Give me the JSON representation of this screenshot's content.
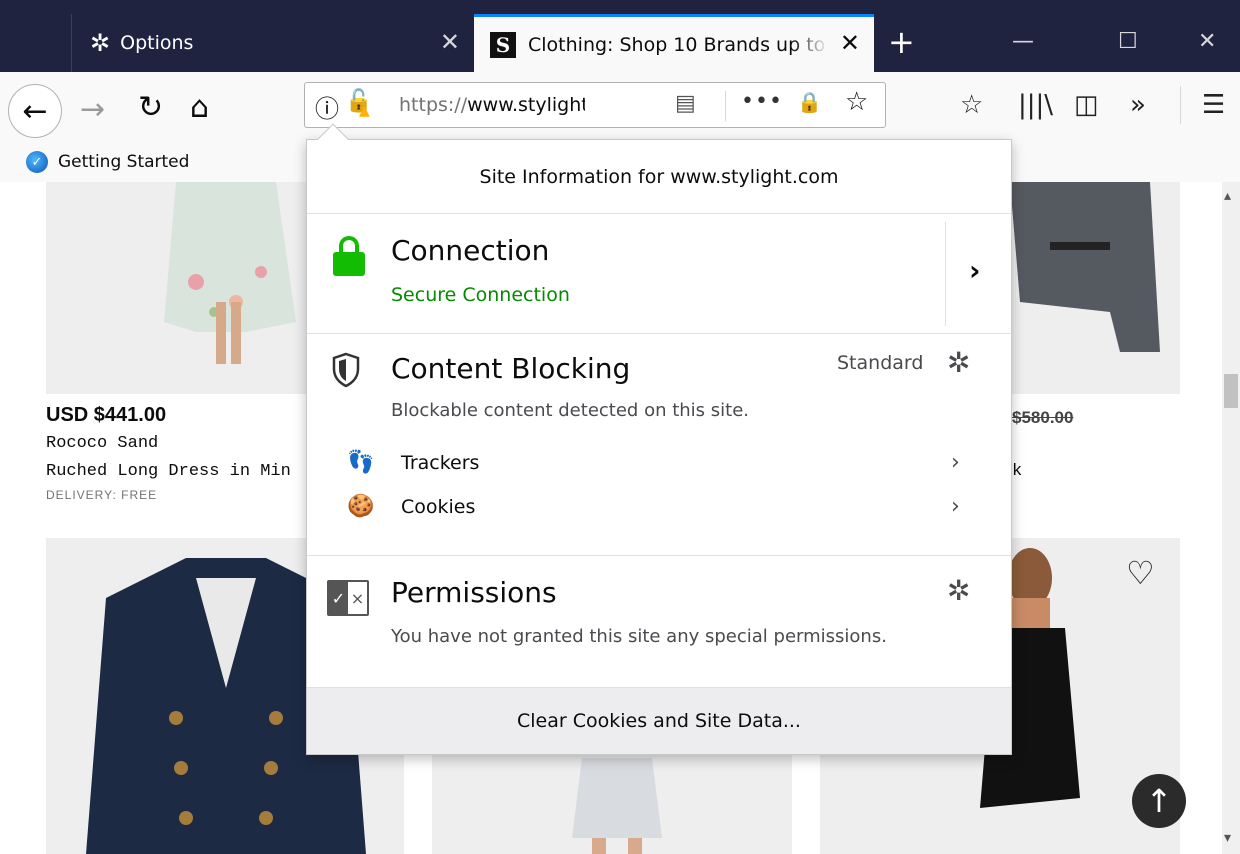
{
  "tabs": [
    {
      "title": "Options",
      "icon": "gear-icon",
      "active": false
    },
    {
      "title": "Clothing: Shop 10 Brands up to",
      "icon": "stylight-favicon",
      "favicon_letter": "S",
      "active": true
    }
  ],
  "window_controls": {
    "new_tab": "+",
    "minimize": "—",
    "maximize": "☐",
    "close": "✕"
  },
  "navbar": {
    "url_scheme": "https://",
    "url_host": "www.stylight",
    "icons": [
      "back-arrow-icon",
      "forward-arrow-icon",
      "reload-icon",
      "home-icon",
      "info-icon",
      "broken-lock-icon",
      "reader-view-icon",
      "page-actions-icon",
      "secure-lock-icon",
      "star-icon",
      "bookmarks-icon",
      "library-icon",
      "sidebar-icon",
      "overflow-icon",
      "menu-icon"
    ]
  },
  "bookmarks_toolbar": {
    "items": [
      {
        "label": "Getting Started"
      }
    ]
  },
  "products": [
    {
      "price": "USD $441.00",
      "brand": "Rococo Sand",
      "name": "Ruched Long Dress in Min",
      "delivery": "DELIVERY: FREE"
    },
    {
      "old_price": "$580.00",
      "name_fragment": "k"
    }
  ],
  "panel": {
    "header": "Site Information for www.stylight.com",
    "connection": {
      "title": "Connection",
      "status": "Secure Connection",
      "status_color": "#058b00"
    },
    "content_blocking": {
      "title": "Content Blocking",
      "mode": "Standard",
      "description": "Blockable content detected on this site.",
      "items": [
        {
          "label": "Trackers",
          "icon": "trackers-icon"
        },
        {
          "label": "Cookies",
          "icon": "cookie-icon"
        }
      ]
    },
    "permissions": {
      "title": "Permissions",
      "description": "You have not granted this site any special permissions."
    },
    "clear_button": "Clear Cookies and Site Data..."
  },
  "colors": {
    "tabbar_bg": "#202340",
    "active_tab_accent": "#0a84ff",
    "secure_green": "#12bc00",
    "warning": "#ffb000"
  }
}
